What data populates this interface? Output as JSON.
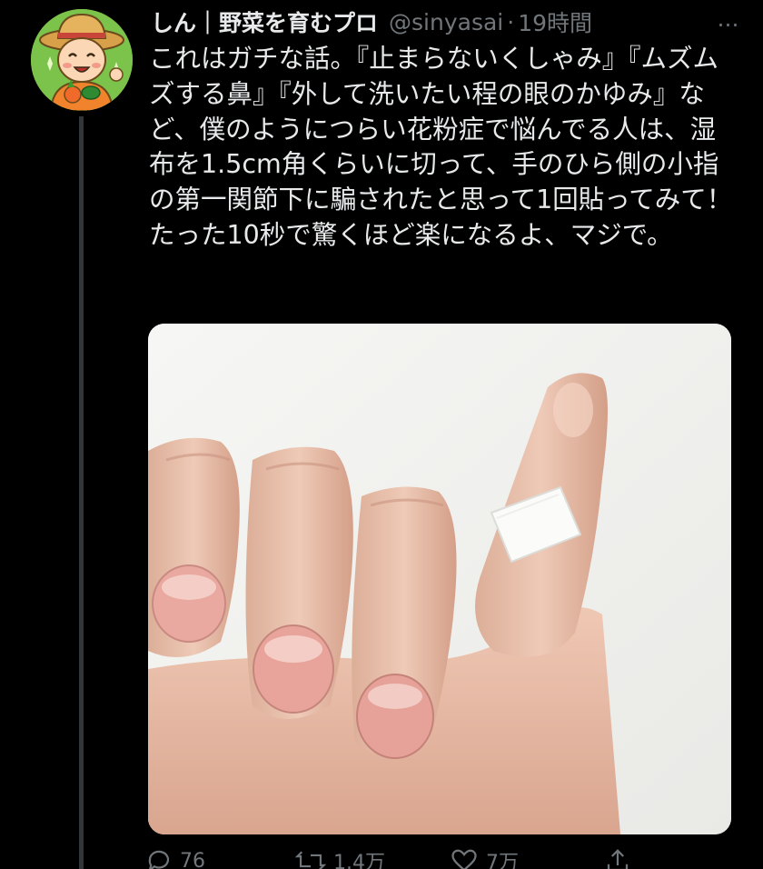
{
  "tweet": {
    "display_name": "しん｜野菜を育むプロ",
    "handle": "@sinyasai",
    "separator": "·",
    "time": "19時間",
    "text": "これはガチな話。『止まらないくしゃみ』『ムズムズする鼻』『外して洗いたい程の眼のかゆみ』など、僕のようにつらい花粉症で悩んでる人は、湿布を1.5cm角くらいに切って、手のひら側の小指の第一関節下に騙されたと思って1回貼ってみて！たった10秒で驚くほど楽になるよ、マジで。",
    "more_icon": "…"
  },
  "actions": {
    "reply_icon": "reply-icon",
    "reply_count": "76",
    "retweet_icon": "retweet-icon",
    "retweet_count": "1.4万",
    "like_icon": "heart-icon",
    "like_count": "7万",
    "share_icon": "share-icon"
  },
  "colors": {
    "background": "#000000",
    "text": "#e7e9ea",
    "muted": "#71767b",
    "thread_line": "#333639"
  }
}
